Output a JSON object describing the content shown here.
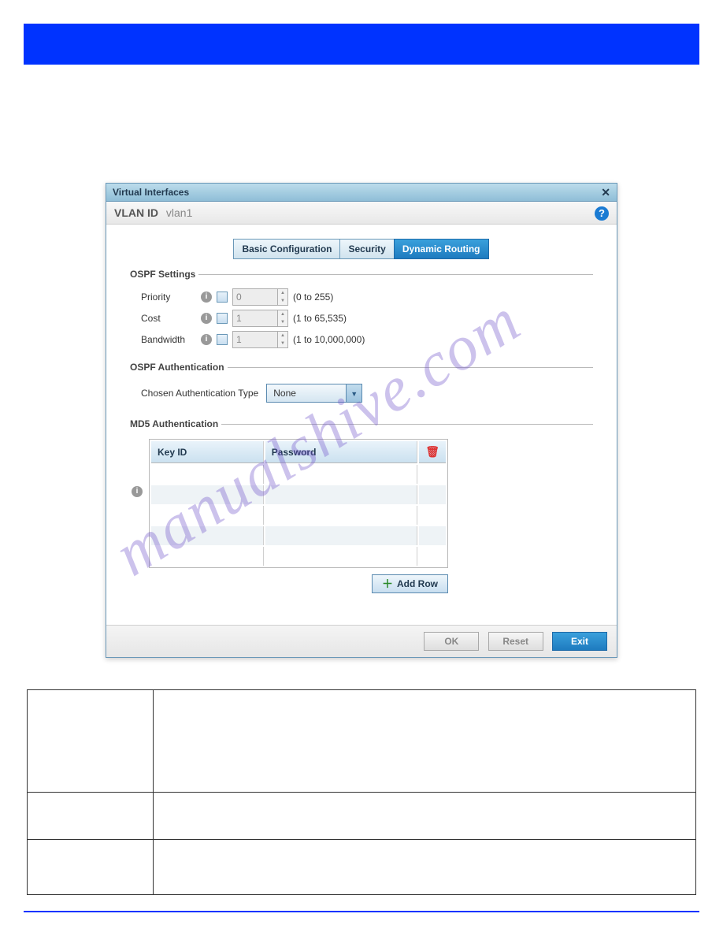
{
  "watermark": "manualshive.com",
  "dialog": {
    "window_title": "Virtual Interfaces",
    "subheader": {
      "label": "VLAN ID",
      "value": "vlan1"
    },
    "tabs": [
      {
        "label": "Basic Configuration"
      },
      {
        "label": "Security"
      },
      {
        "label": "Dynamic Routing"
      }
    ],
    "ospf_settings": {
      "legend": "OSPF Settings",
      "rows": [
        {
          "label": "Priority",
          "value": "0",
          "range": "(0 to 255)"
        },
        {
          "label": "Cost",
          "value": "1",
          "range": "(1 to 65,535)"
        },
        {
          "label": "Bandwidth",
          "value": "1",
          "range": "(1 to 10,000,000)"
        }
      ]
    },
    "ospf_auth": {
      "legend": "OSPF Authentication",
      "label": "Chosen Authentication Type",
      "selected": "None"
    },
    "md5": {
      "legend": "MD5 Authentication",
      "cols": {
        "key": "Key ID",
        "pwd": "Password"
      },
      "add_row": "Add Row"
    },
    "buttons": {
      "ok": "OK",
      "reset": "Reset",
      "exit": "Exit"
    }
  },
  "doc_table": {
    "r1": {
      "k": "",
      "v": ""
    },
    "r2": {
      "k": "",
      "v": ""
    },
    "r3": {
      "k": "",
      "v": ""
    }
  }
}
